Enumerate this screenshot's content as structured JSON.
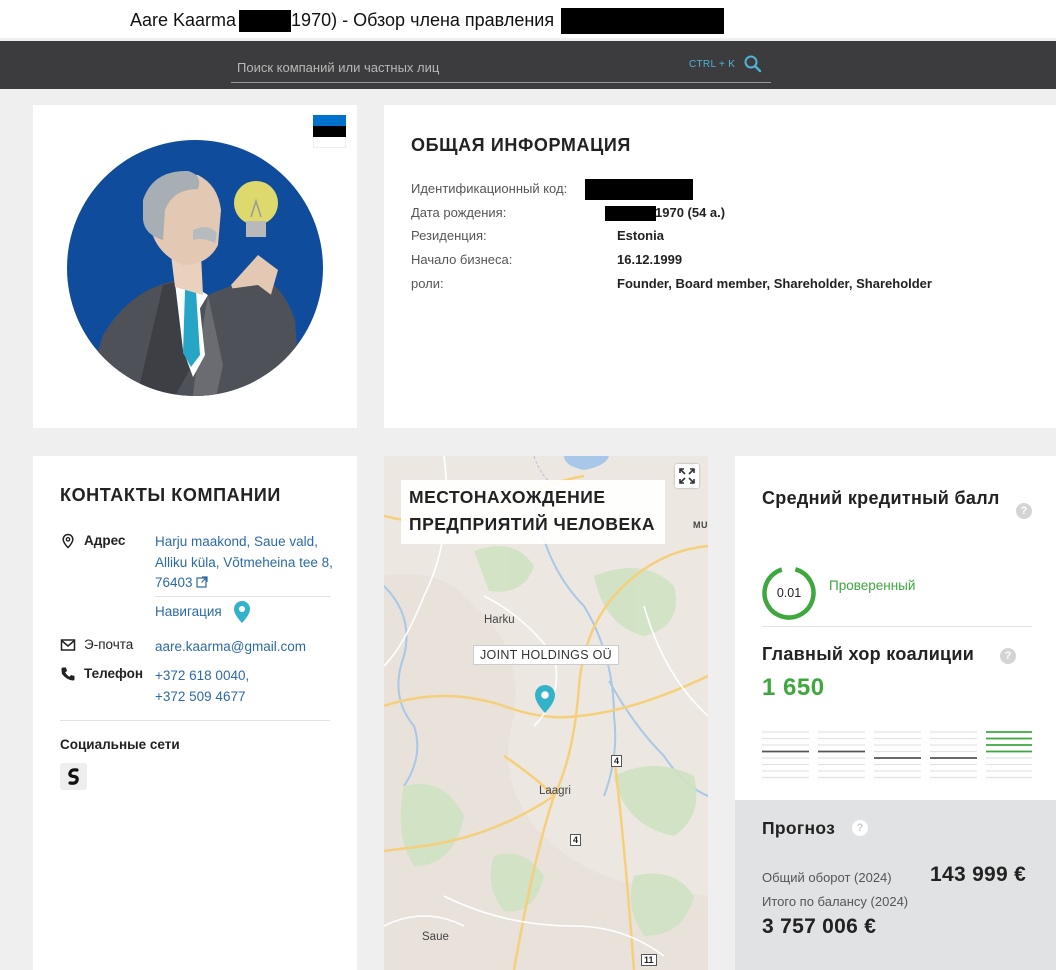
{
  "window": {
    "title_prefix": "Aare Kaarma (",
    "title_year": "1970) - Обзор члена правления"
  },
  "search": {
    "placeholder": "Поиск компаний или частных лиц",
    "shortcut": "CTRL + K",
    "icon": "search-icon"
  },
  "profile": {
    "flag_colors": [
      "#0072ce",
      "#000000",
      "#ffffff"
    ]
  },
  "general": {
    "title": "ОБЩАЯ ИНФОРМАЦИЯ",
    "rows": [
      {
        "label": "Идентификационный код:",
        "value": ""
      },
      {
        "label": "Дата рождения:",
        "value": "1970 (54 a.)"
      },
      {
        "label": "Резиденция:",
        "value": "Estonia"
      },
      {
        "label": "Начало бизнеса:",
        "value": "16.12.1999"
      },
      {
        "label": "роли:",
        "value": "Founder, Board member, Shareholder, Shareholder"
      }
    ]
  },
  "contacts": {
    "title": "КОНТАКТЫ КОМПАНИИ",
    "address_label": "Адрес",
    "address_value": "Harju maakond, Saue vald, Alliku küla, Võtmeheina tee 8, 76403",
    "navigation_label": "Навигация",
    "email_label": "Э-почта",
    "email_value": "aare.kaarma@gmail.com",
    "phone_label": "Телефон",
    "phone_1": "+372 618 0040,",
    "phone_2": "+372 509 4677",
    "social_title": "Социальные сети"
  },
  "map": {
    "title_line1": "МЕСТОНАХОЖДЕНИЕ",
    "title_line2": "ПРЕДПРИЯТИЙ ЧЕЛОВЕКА",
    "company_tag": "JOINT HOLDINGS OÜ",
    "towns": [
      "Harku",
      "Laagri",
      "Saue",
      "MU"
    ],
    "road_signs": [
      "4",
      "4",
      "11"
    ]
  },
  "credit": {
    "title": "Средний кредитный балл",
    "score": "0.01",
    "status": "Проверенный",
    "coalition_title": "Главный хор коалиции",
    "coalition_value": "1 650",
    "accent": "#3ea73e"
  },
  "forecast": {
    "title": "Прогноз",
    "turnover_label": "Общий оборот (2024)",
    "turnover_value": "143 999 €",
    "balance_label": "Итого по балансу (2024)",
    "balance_value": "3 757 006 €"
  }
}
